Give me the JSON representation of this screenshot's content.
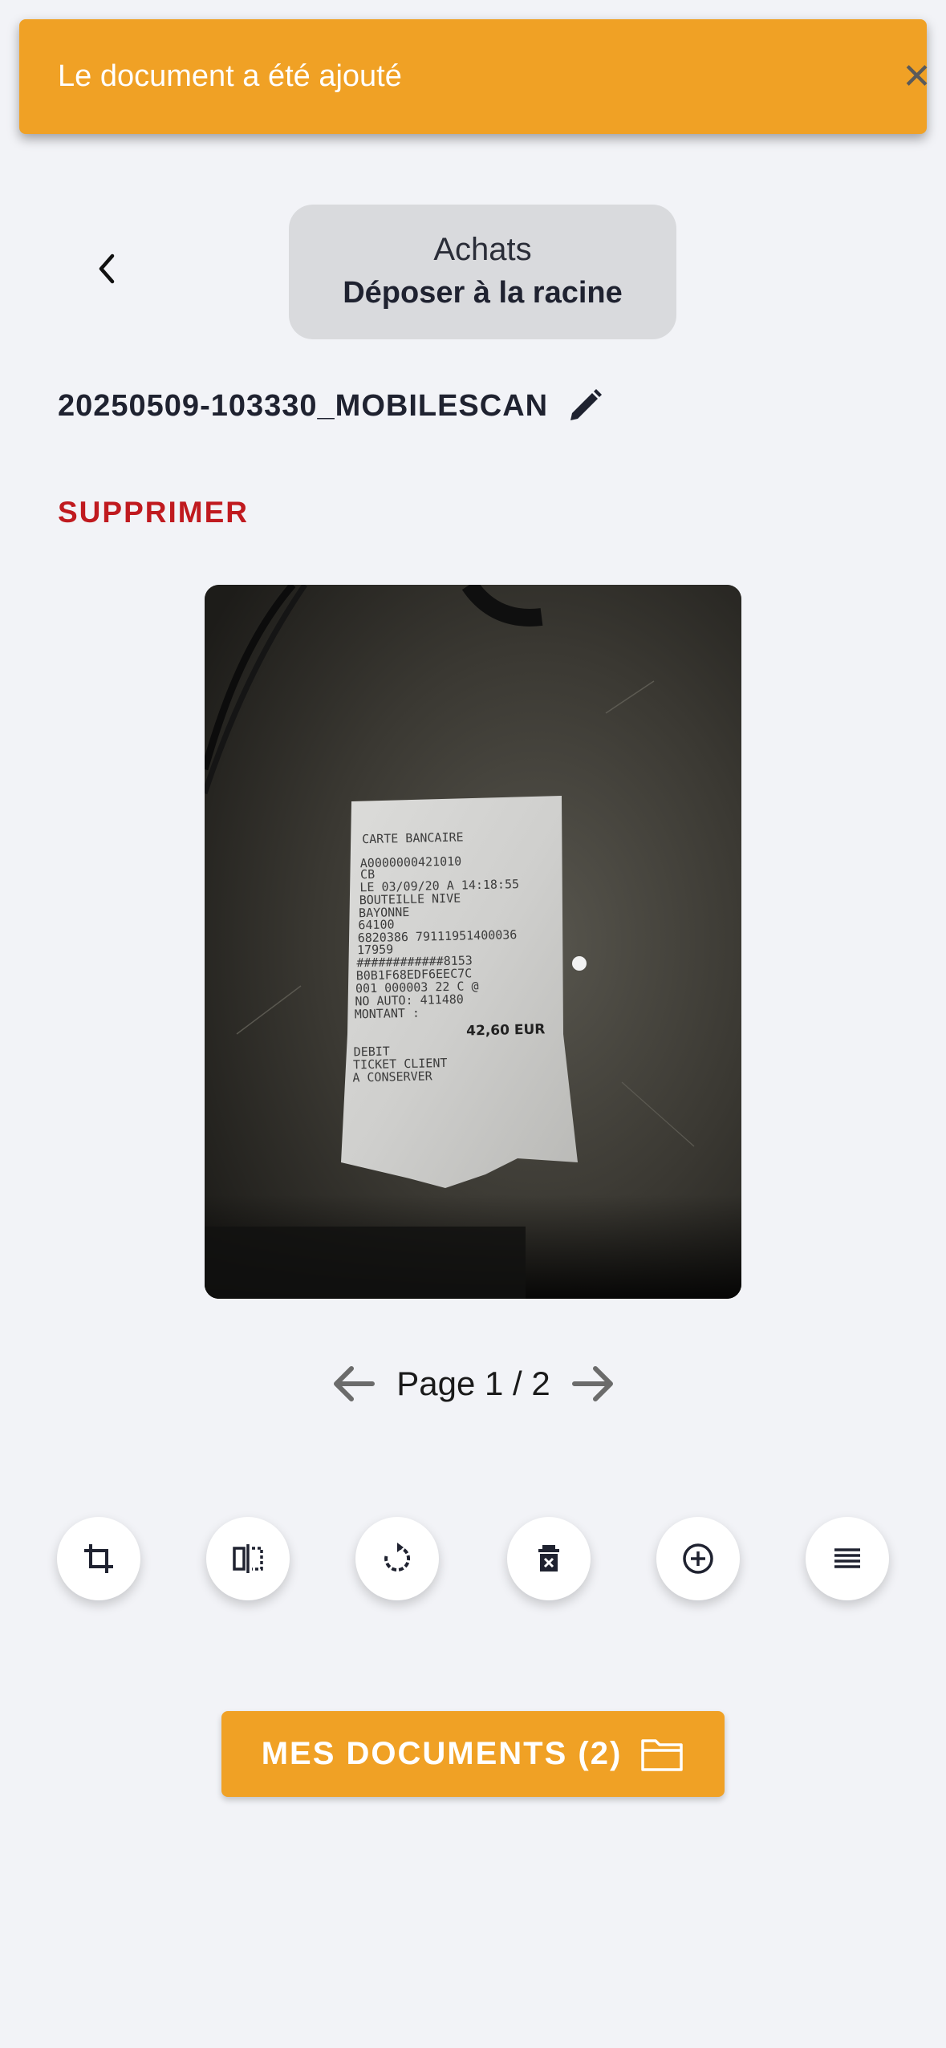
{
  "toast": {
    "message": "Le document a été ajouté"
  },
  "header": {
    "folder": "Achats",
    "action": "Déposer à la racine"
  },
  "document": {
    "filename": "20250509-103330_MOBILESCAN",
    "delete_label": "SUPPRIMER"
  },
  "receipt": {
    "lines": [
      "CARTE BANCAIRE",
      "A0000000421010",
      "CB",
      "LE 03/09/20 A 14:18:55",
      "BOUTEILLE NIVE",
      "BAYONNE",
      "64100",
      "6820386 79111951400036",
      "17959",
      "############8153",
      "B0B1F68EDF6EEC7C",
      "001 000003 22 C @",
      "NO AUTO: 411480",
      "MONTANT :",
      "42,60 EUR",
      "DEBIT",
      "TICKET CLIENT",
      "A CONSERVER"
    ]
  },
  "pager": {
    "label": "Page 1 / 2"
  },
  "toolbar": {
    "icons": [
      "crop-icon",
      "flip-icon",
      "rotate-icon",
      "delete-page-icon",
      "add-page-icon",
      "reorder-icon"
    ]
  },
  "footer": {
    "documents_label": "MES DOCUMENTS (2)"
  },
  "colors": {
    "accent": "#f0a125",
    "danger": "#c01a1f",
    "background": "#f2f3f7"
  }
}
